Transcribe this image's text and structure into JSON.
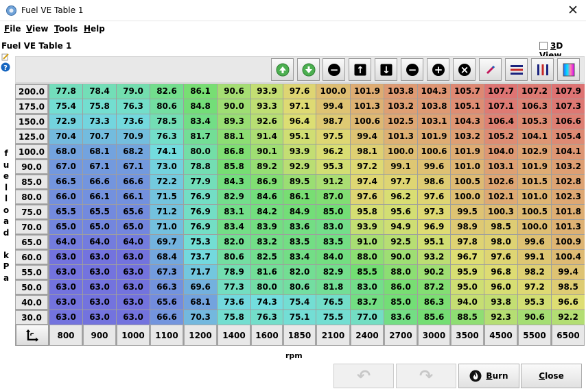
{
  "window": {
    "title": "Fuel VE Table 1",
    "close_glyph": "✕"
  },
  "menu": [
    {
      "mnemonic": "F",
      "rest": "ile"
    },
    {
      "mnemonic": "V",
      "rest": "iew"
    },
    {
      "mnemonic": "T",
      "rest": "ools"
    },
    {
      "mnemonic": "H",
      "rest": "elp"
    }
  ],
  "panel": {
    "title": "Fuel VE Table 1",
    "view3d_mnemonic": "3",
    "view3d_rest": "D View",
    "view3d_checked": false
  },
  "toolbar": [
    {
      "name": "increase-green-icon",
      "glyph": "▲"
    },
    {
      "name": "decrease-green-icon",
      "glyph": "▼"
    },
    {
      "name": "decrement-icon",
      "glyph": "−"
    },
    {
      "name": "arrow-up-icon",
      "glyph": "↑"
    },
    {
      "name": "arrow-down-icon",
      "glyph": "↓"
    },
    {
      "name": "minus-icon",
      "glyph": "−"
    },
    {
      "name": "plus-icon",
      "glyph": "+"
    },
    {
      "name": "multiply-icon",
      "glyph": "×"
    },
    {
      "name": "interpolate-pen-icon",
      "glyph": ""
    },
    {
      "name": "horizontal-smooth-icon",
      "glyph": ""
    },
    {
      "name": "vertical-smooth-icon",
      "glyph": ""
    },
    {
      "name": "color-gradient-icon",
      "glyph": ""
    }
  ],
  "table": {
    "y_axis_label": "fuelload kPa",
    "x_axis_label": "rpm",
    "y_bins": [
      "200.0",
      "175.0",
      "150.0",
      "125.0",
      "100.0",
      "90.0",
      "85.0",
      "80.0",
      "75.0",
      "70.0",
      "65.0",
      "60.0",
      "55.0",
      "50.0",
      "40.0",
      "30.0"
    ],
    "x_bins": [
      "800",
      "900",
      "1000",
      "1100",
      "1200",
      "1400",
      "1600",
      "1850",
      "2100",
      "2400",
      "2700",
      "3000",
      "3500",
      "4500",
      "5500",
      "6500"
    ],
    "min": 63.0,
    "max": 107.9,
    "values": [
      [
        "77.8",
        "78.4",
        "79.0",
        "82.6",
        "86.1",
        "90.6",
        "93.9",
        "97.6",
        "100.0",
        "101.9",
        "103.8",
        "104.3",
        "105.7",
        "107.7",
        "107.2",
        "107.9"
      ],
      [
        "75.4",
        "75.8",
        "76.3",
        "80.6",
        "84.8",
        "90.0",
        "93.3",
        "97.1",
        "99.4",
        "101.3",
        "103.2",
        "103.8",
        "105.1",
        "107.1",
        "106.3",
        "107.3"
      ],
      [
        "72.9",
        "73.3",
        "73.6",
        "78.5",
        "83.4",
        "89.3",
        "92.6",
        "96.4",
        "98.7",
        "100.6",
        "102.5",
        "103.1",
        "104.3",
        "106.4",
        "105.3",
        "106.6"
      ],
      [
        "70.4",
        "70.7",
        "70.9",
        "76.3",
        "81.7",
        "88.1",
        "91.4",
        "95.1",
        "97.5",
        "99.4",
        "101.3",
        "101.9",
        "103.2",
        "105.2",
        "104.1",
        "105.4"
      ],
      [
        "68.0",
        "68.1",
        "68.2",
        "74.1",
        "80.0",
        "86.8",
        "90.1",
        "93.9",
        "96.2",
        "98.1",
        "100.0",
        "100.6",
        "101.9",
        "104.0",
        "102.9",
        "104.1"
      ],
      [
        "67.0",
        "67.1",
        "67.1",
        "73.0",
        "78.8",
        "85.8",
        "89.2",
        "92.9",
        "95.3",
        "97.2",
        "99.1",
        "99.6",
        "101.0",
        "103.1",
        "101.9",
        "103.2"
      ],
      [
        "66.5",
        "66.6",
        "66.6",
        "72.2",
        "77.9",
        "84.3",
        "86.9",
        "89.5",
        "91.2",
        "97.4",
        "97.7",
        "98.6",
        "100.5",
        "102.6",
        "101.5",
        "102.8"
      ],
      [
        "66.0",
        "66.1",
        "66.1",
        "71.5",
        "76.9",
        "82.9",
        "84.6",
        "86.1",
        "87.0",
        "97.6",
        "96.2",
        "97.6",
        "100.0",
        "102.1",
        "101.0",
        "102.3"
      ],
      [
        "65.5",
        "65.5",
        "65.6",
        "71.2",
        "76.9",
        "83.1",
        "84.2",
        "84.9",
        "85.0",
        "95.8",
        "95.6",
        "97.3",
        "99.5",
        "100.3",
        "100.5",
        "101.8"
      ],
      [
        "65.0",
        "65.0",
        "65.0",
        "71.0",
        "76.9",
        "83.4",
        "83.9",
        "83.6",
        "83.0",
        "93.9",
        "94.9",
        "96.9",
        "98.9",
        "98.5",
        "100.0",
        "101.3"
      ],
      [
        "64.0",
        "64.0",
        "64.0",
        "69.7",
        "75.3",
        "82.0",
        "83.2",
        "83.5",
        "83.5",
        "91.0",
        "92.5",
        "95.1",
        "97.8",
        "98.0",
        "99.6",
        "100.9"
      ],
      [
        "63.0",
        "63.0",
        "63.0",
        "68.4",
        "73.7",
        "80.6",
        "82.5",
        "83.4",
        "84.0",
        "88.0",
        "90.0",
        "93.2",
        "96.7",
        "97.6",
        "99.1",
        "100.4"
      ],
      [
        "63.0",
        "63.0",
        "63.0",
        "67.3",
        "71.7",
        "78.9",
        "81.6",
        "82.0",
        "82.9",
        "85.5",
        "88.0",
        "90.2",
        "95.9",
        "96.8",
        "98.2",
        "99.4"
      ],
      [
        "63.0",
        "63.0",
        "63.0",
        "66.3",
        "69.6",
        "77.3",
        "80.0",
        "80.6",
        "81.8",
        "83.0",
        "86.0",
        "87.2",
        "95.0",
        "96.0",
        "97.2",
        "98.5"
      ],
      [
        "63.0",
        "63.0",
        "63.0",
        "65.6",
        "68.1",
        "73.6",
        "74.3",
        "75.4",
        "76.5",
        "83.7",
        "85.0",
        "86.3",
        "94.0",
        "93.8",
        "95.3",
        "96.6"
      ],
      [
        "63.0",
        "63.0",
        "63.0",
        "66.6",
        "70.3",
        "75.8",
        "76.3",
        "75.1",
        "75.5",
        "77.0",
        "83.6",
        "85.6",
        "88.5",
        "92.3",
        "90.6",
        "92.2"
      ]
    ]
  },
  "buttons": {
    "undo_glyph": "↶",
    "redo_glyph": "↷",
    "burn_mnemonic": "B",
    "burn_rest": "urn",
    "close_mnemonic": "C",
    "close_rest": "lose"
  }
}
